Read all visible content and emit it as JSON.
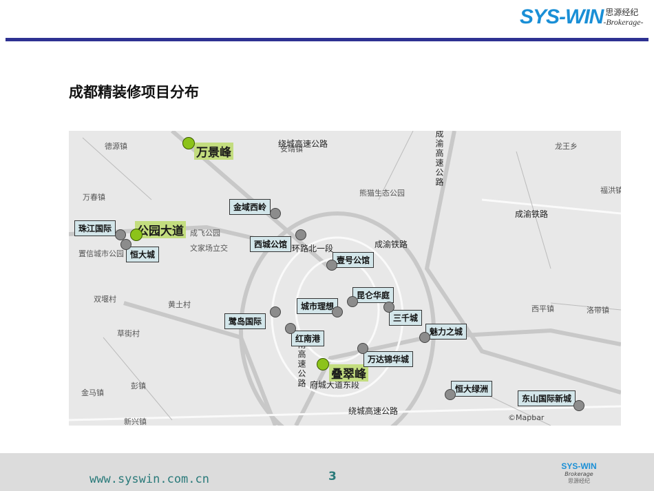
{
  "header": {
    "logo_text": "SYS-WIN",
    "logo_cn": "思源经纪",
    "logo_en": "-Brokerage-"
  },
  "title": "成都精装修项目分布",
  "map": {
    "projects_highlight": [
      "万景峰",
      "公园大道",
      "叠翠峰"
    ],
    "projects": [
      "珠江国际",
      "恒大城",
      "金域西岭",
      "西城公馆",
      "壹号公馆",
      "昆仑华庭",
      "城市理想",
      "三千城",
      "鹭岛国际",
      "红南港",
      "魅力之城",
      "万达锦华城",
      "恒大绿洲",
      "东山国际新城"
    ],
    "places": [
      "德源镇",
      "万春镇",
      "安靖镇",
      "龙王乡",
      "福洪镇",
      "双堰村",
      "黄土村",
      "草街村",
      "彭镇",
      "金马镇",
      "新兴镇",
      "西平镇",
      "洛带镇",
      "熊猫生态公园",
      "文家场立交",
      "置信城市公园",
      "成飞公园"
    ],
    "roads": [
      "成渝铁路",
      "成渝铁路",
      "绕城高速公路",
      "三环路北一段",
      "府城大道东段",
      "绕城高速公路",
      "成渝高速公路",
      "成南高速公路"
    ],
    "copyright": "©Mapbar"
  },
  "footer": {
    "url": "www.syswin.com.cn",
    "page": "3",
    "logo_text": "SYS-WIN",
    "logo_en": "Brokerage",
    "logo_cn": "思源经纪"
  },
  "colors": {
    "rule": "#2e3192",
    "highlight": "#c2dd7a",
    "marker_green": "#8cc31a",
    "box": "#d3e6ea"
  }
}
